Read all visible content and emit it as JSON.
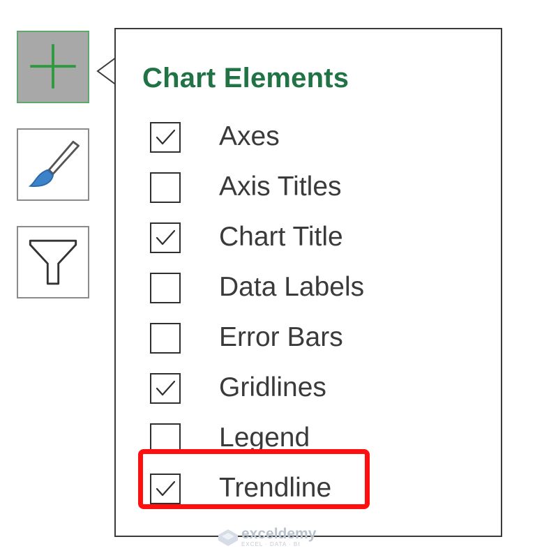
{
  "side_buttons": [
    {
      "icon": "plus-icon",
      "active": true
    },
    {
      "icon": "paintbrush-icon",
      "active": false
    },
    {
      "icon": "funnel-icon",
      "active": false
    }
  ],
  "flyout": {
    "title": "Chart Elements",
    "items": [
      {
        "label": "Axes",
        "checked": true
      },
      {
        "label": "Axis Titles",
        "checked": false
      },
      {
        "label": "Chart Title",
        "checked": true
      },
      {
        "label": "Data Labels",
        "checked": false
      },
      {
        "label": "Error Bars",
        "checked": false
      },
      {
        "label": "Gridlines",
        "checked": true
      },
      {
        "label": "Legend",
        "checked": false
      },
      {
        "label": "Trendline",
        "checked": true
      }
    ]
  },
  "highlight": {
    "target": "Trendline",
    "color": "#ff1010"
  },
  "colors": {
    "title_green": "#217346",
    "active_button_bg": "#a8a8a8",
    "plus_green": "#2e9a3f",
    "brush_blue": "#3b82c9"
  },
  "watermark": {
    "name": "exceldemy",
    "tagline": "EXCEL · DATA · BI"
  }
}
